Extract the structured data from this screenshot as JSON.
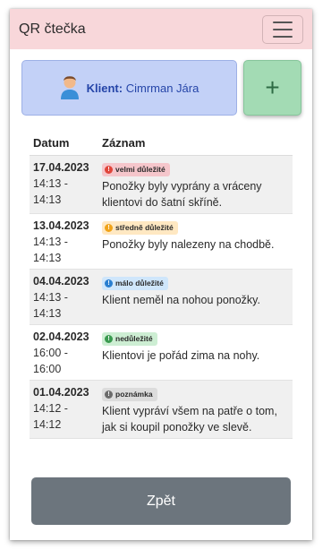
{
  "navbar": {
    "brand": "QR čtečka",
    "menu_icon": "hamburger-icon"
  },
  "client": {
    "label": "Klient:",
    "name": "Cimrman Jára",
    "icon": "user-icon"
  },
  "add_button": {
    "label": "+"
  },
  "table": {
    "headers": {
      "date": "Datum",
      "record": "Záznam"
    },
    "rows": [
      {
        "date": "17.04.2023",
        "time": "14:13 -",
        "time_end": "14:13",
        "badge": "velmi důležité",
        "badge_bg": "#f5c6cb",
        "dot": "#e0453a",
        "record": "Ponožky byly vyprány a vráceny klientovi do šatní skříně."
      },
      {
        "date": "13.04.2023",
        "time": "14:13 -",
        "time_end": "14:13",
        "badge": "středně důležité",
        "badge_bg": "#ffe8c2",
        "dot": "#f0a31a",
        "record": "Ponožky byly nalezeny na chodbě."
      },
      {
        "date": "04.04.2023",
        "time": "14:13 -",
        "time_end": "14:13",
        "badge": "málo důležité",
        "badge_bg": "#cfe6fb",
        "dot": "#2a7fd0",
        "record": "Klient neměl na nohou ponožky."
      },
      {
        "date": "02.04.2023",
        "time": "16:00 -",
        "time_end": "16:00",
        "badge": "nedůležité",
        "badge_bg": "#cdeed3",
        "dot": "#3a9a4f",
        "record": "Klientovi je pořád zima na nohy."
      },
      {
        "date": "01.04.2023",
        "time": "14:12 -",
        "time_end": "14:12",
        "badge": "poznámka",
        "badge_bg": "#dcdcdc",
        "dot": "#6b6b6b",
        "record": "Klient vypráví všem na patře o tom, jak si koupil ponožky ve slevě."
      }
    ]
  },
  "back_button": {
    "label": "Zpět"
  }
}
